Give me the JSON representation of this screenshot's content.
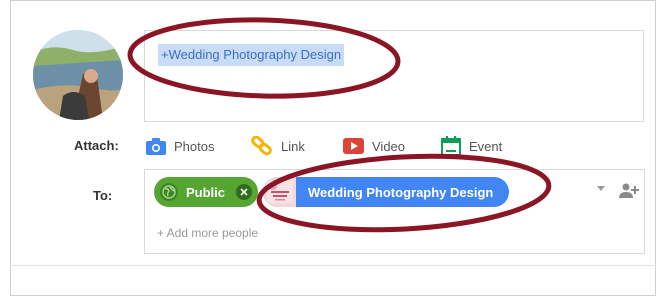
{
  "compose": {
    "mention": "+Wedding Photography Design"
  },
  "attach": {
    "label": "Attach:",
    "items": [
      {
        "label": "Photos",
        "icon": "camera-icon",
        "color": "#4285f4"
      },
      {
        "label": "Link",
        "icon": "link-icon",
        "color": "#f4b400"
      },
      {
        "label": "Video",
        "icon": "video-icon",
        "color": "#db4437"
      },
      {
        "label": "Event",
        "icon": "calendar-icon",
        "color": "#0f9d58"
      }
    ]
  },
  "to": {
    "label": "To:",
    "chips": [
      {
        "label": "Public",
        "icon": "globe-icon",
        "color": "#54a532"
      },
      {
        "label": "Wedding Photography Design",
        "icon": "page-thumbnail",
        "color": "#4285f4"
      }
    ],
    "add_more": "+ Add more people"
  },
  "colors": {
    "annotation": "#8b1524"
  }
}
